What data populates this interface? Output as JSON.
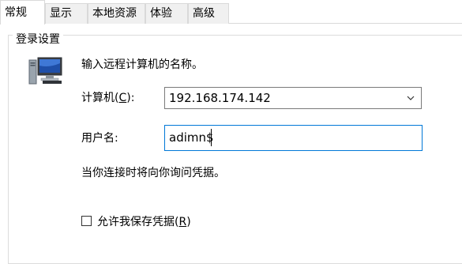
{
  "tabs": [
    {
      "label": "常规",
      "active": true
    },
    {
      "label": "显示",
      "active": false
    },
    {
      "label": "本地资源",
      "active": false
    },
    {
      "label": "体验",
      "active": false
    },
    {
      "label": "高级",
      "active": false
    }
  ],
  "group": {
    "title": "登录设置",
    "icon": "computer-icon",
    "intro_text": "输入远程计算机的名称。",
    "computer_label": "计算机(",
    "computer_hotkey": "C",
    "computer_label_end": "):",
    "computer_value": "192.168.174.142",
    "username_label": "用户名:",
    "username_value": "adimn$",
    "prompt_text": "当你连接时将向你询问凭据。",
    "save_creds_label": "允许我保存凭据(",
    "save_creds_hotkey": "R",
    "save_creds_label_end": ")",
    "save_creds_checked": false
  },
  "colors": {
    "focus_border": "#0078d7",
    "tab_inactive_bg": "#f0f0f0"
  }
}
